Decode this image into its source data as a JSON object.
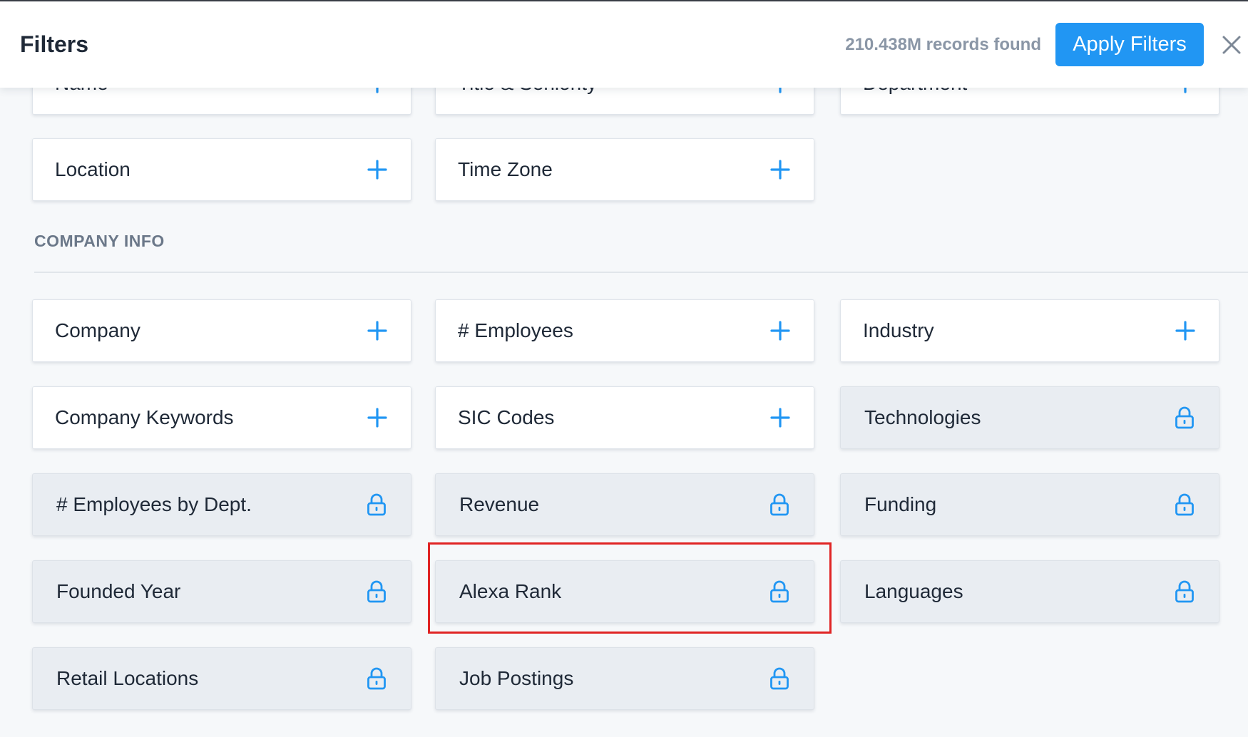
{
  "header": {
    "title": "Filters",
    "records": "210.438M records found",
    "apply_label": "Apply Filters",
    "close_icon": "close-icon"
  },
  "partial_row": [
    "Name",
    "Title & Seniority",
    "Department"
  ],
  "contact_filters": [
    "Location",
    "Time Zone"
  ],
  "company_section": {
    "title": "COMPANY INFO",
    "filters": [
      {
        "label": "Company",
        "state": "add"
      },
      {
        "label": "# Employees",
        "state": "add"
      },
      {
        "label": "Industry",
        "state": "add"
      },
      {
        "label": "Company Keywords",
        "state": "add"
      },
      {
        "label": "SIC Codes",
        "state": "add"
      },
      {
        "label": "Technologies",
        "state": "locked"
      },
      {
        "label": "# Employees by Dept.",
        "state": "locked"
      },
      {
        "label": "Revenue",
        "state": "locked"
      },
      {
        "label": "Funding",
        "state": "locked"
      },
      {
        "label": "Founded Year",
        "state": "locked"
      },
      {
        "label": "Alexa Rank",
        "state": "locked",
        "highlighted": true
      },
      {
        "label": "Languages",
        "state": "locked"
      },
      {
        "label": "Retail Locations",
        "state": "locked"
      },
      {
        "label": "Job Postings",
        "state": "locked"
      }
    ]
  },
  "colors": {
    "accent": "#2196f3",
    "highlight_border": "#e02424",
    "locked_card": "#e9edf2",
    "text": "#1f2937",
    "muted": "#8a96a6"
  }
}
